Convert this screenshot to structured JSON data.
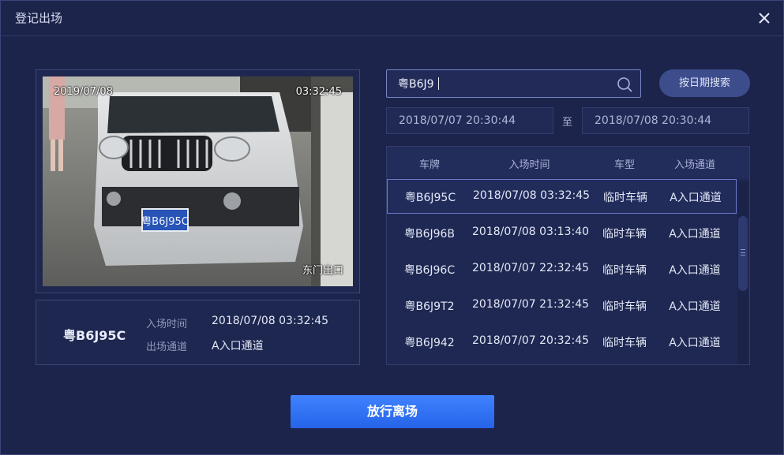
{
  "dialog": {
    "title": "登记出场"
  },
  "camera": {
    "date": "2019/07/08",
    "time": "03:32:45",
    "location": "东门出口",
    "plate_text": "粤B6J95C"
  },
  "info": {
    "plate": "粤B6J95C",
    "entry_time_label": "入场时间",
    "entry_time": "2018/07/08 03:32:45",
    "exit_channel_label": "出场通道",
    "exit_channel": "A入口通道"
  },
  "search": {
    "value": "粤B6J9",
    "icon": "search-icon",
    "date_search_label": "按日期搜索",
    "date_from": "2018/07/07 20:30:44",
    "date_separator": "至",
    "date_to": "2018/07/08 20:30:44"
  },
  "table": {
    "headers": [
      "车牌",
      "入场时间",
      "车型",
      "入场通道"
    ],
    "rows": [
      {
        "plate": "粤B6J95C",
        "time": "2018/07/08 03:32:45",
        "type": "临时车辆",
        "channel": "A入口通道"
      },
      {
        "plate": "粤B6J96B",
        "time": "2018/07/08 03:13:40",
        "type": "临时车辆",
        "channel": "A入口通道"
      },
      {
        "plate": "粤B6J96C",
        "time": "2018/07/07 22:32:45",
        "type": "临时车辆",
        "channel": "A入口通道"
      },
      {
        "plate": "粤B6J9T2",
        "time": "2018/07/07 21:32:45",
        "type": "临时车辆",
        "channel": "A入口通道"
      },
      {
        "plate": "粤B6J942",
        "time": "2018/07/07 20:32:45",
        "type": "临时车辆",
        "channel": "A入口通道"
      }
    ]
  },
  "actions": {
    "release_label": "放行离场"
  },
  "colors": {
    "background": "#1c244c",
    "accent": "#2f6ef5",
    "selected_border": "#6b7acb"
  }
}
